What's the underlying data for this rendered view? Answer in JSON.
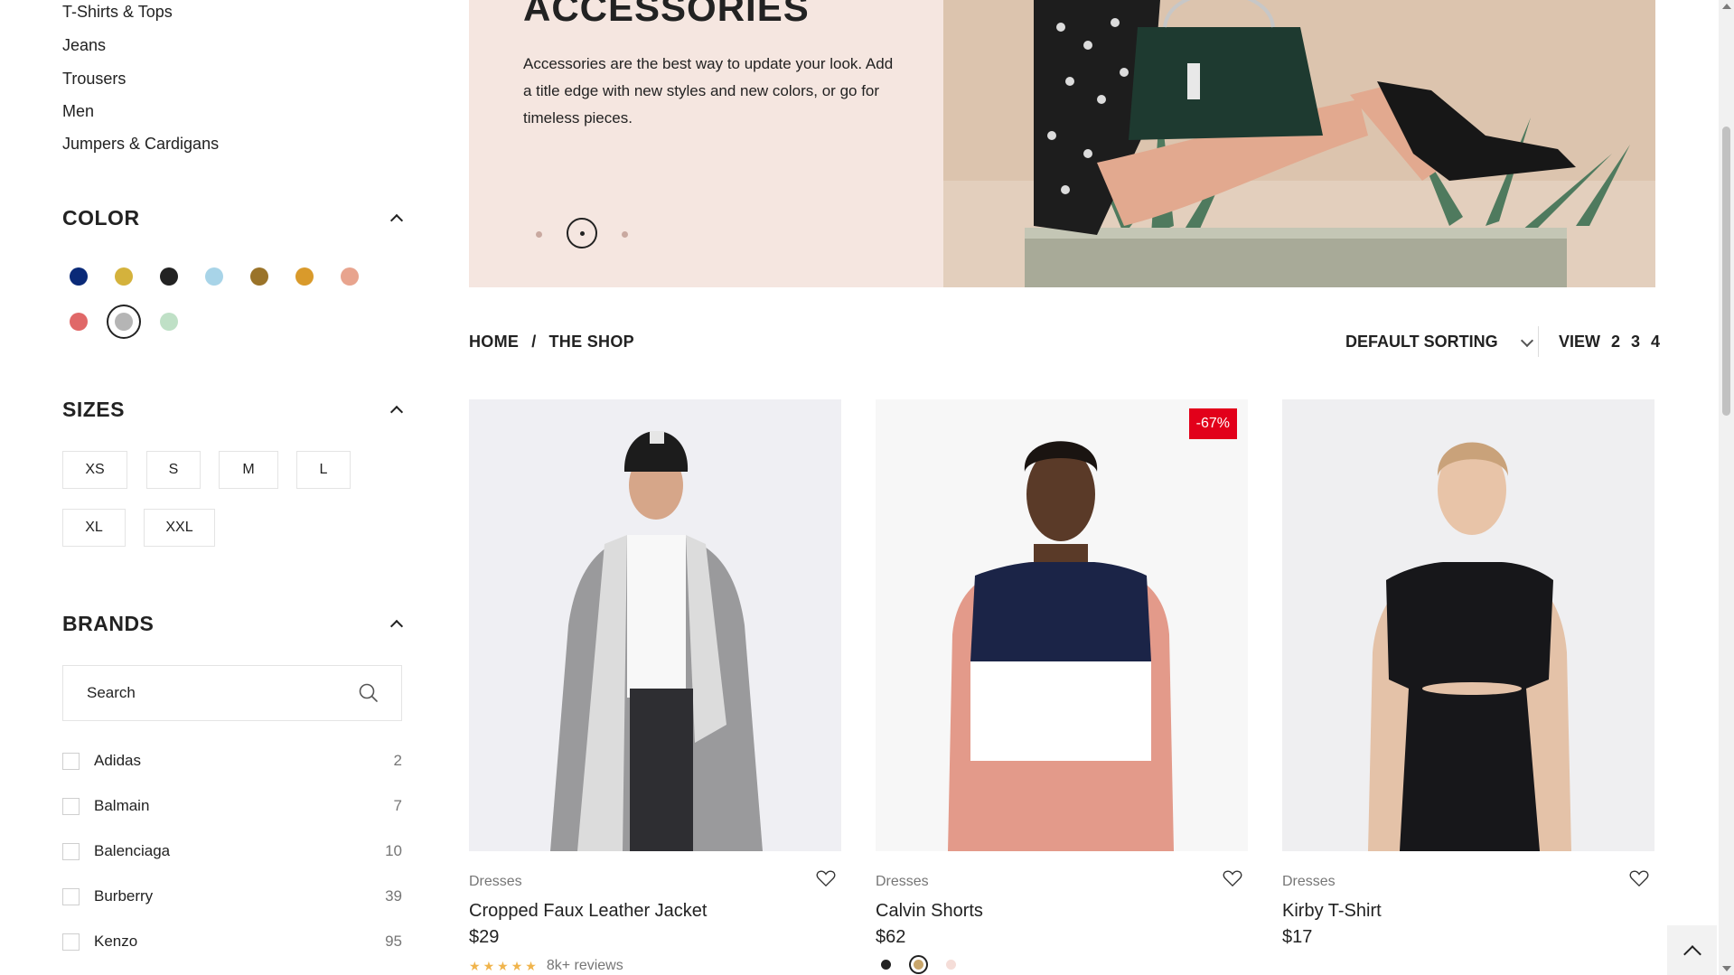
{
  "sidebar": {
    "categories": [
      "T-Shirts & Tops",
      "Jeans",
      "Trousers",
      "Men",
      "Jumpers & Cardigans"
    ],
    "color": {
      "title": "COLOR",
      "swatches": [
        {
          "name": "navy",
          "hex": "#0a2a78"
        },
        {
          "name": "mustard",
          "hex": "#d4b23c"
        },
        {
          "name": "black",
          "hex": "#222222"
        },
        {
          "name": "light-blue",
          "hex": "#a8d4e8"
        },
        {
          "name": "brown",
          "hex": "#9a7329"
        },
        {
          "name": "ochre",
          "hex": "#d99a2b"
        },
        {
          "name": "peach",
          "hex": "#e8a48e"
        },
        {
          "name": "coral",
          "hex": "#e06868"
        },
        {
          "name": "grey",
          "hex": "#b5b5b5",
          "selected": true
        },
        {
          "name": "mint",
          "hex": "#bfe0c6"
        }
      ]
    },
    "sizes": {
      "title": "SIZES",
      "items": [
        "XS",
        "S",
        "M",
        "L",
        "XL",
        "XXL"
      ]
    },
    "brands": {
      "title": "BRANDS",
      "search_placeholder": "Search",
      "items": [
        {
          "name": "Adidas",
          "count": "2"
        },
        {
          "name": "Balmain",
          "count": "7"
        },
        {
          "name": "Balenciaga",
          "count": "10"
        },
        {
          "name": "Burberry",
          "count": "39"
        },
        {
          "name": "Kenzo",
          "count": "95"
        }
      ]
    }
  },
  "hero": {
    "title": "ACCESSORIES",
    "text": "Accessories are the best way to update your look. Add a title edge with new styles and new colors, or go for timeless pieces.",
    "bg_color": "#f5e6e0"
  },
  "toolbar": {
    "breadcrumb_home": "HOME",
    "breadcrumb_sep": "/",
    "breadcrumb_current": "THE SHOP",
    "sorting_label": "DEFAULT SORTING",
    "view_label": "VIEW",
    "view_options": [
      "2",
      "3",
      "4"
    ]
  },
  "products": [
    {
      "category": "Dresses",
      "name": "Cropped Faux Leather Jacket",
      "price": "$29",
      "rating": "5",
      "reviews": "8k+ reviews"
    },
    {
      "category": "Dresses",
      "name": "Calvin Shorts",
      "price": "$62",
      "badge": "-67%",
      "colors": [
        "#222222",
        "#c9a66b",
        "#f5ddd8"
      ]
    },
    {
      "category": "Dresses",
      "name": "Kirby T-Shirt",
      "price": "$17"
    }
  ]
}
